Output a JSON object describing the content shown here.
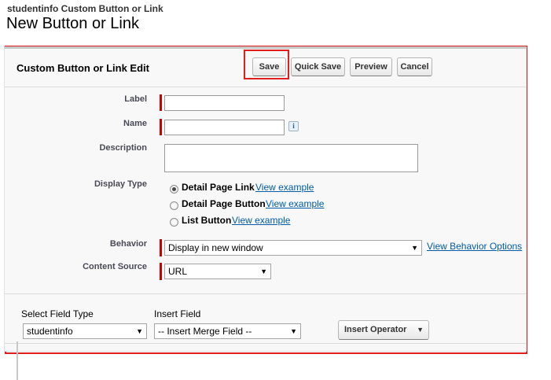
{
  "breadcrumb": "studentinfo Custom Button or Link",
  "page_title": "New Button or Link",
  "panel": {
    "title": "Custom Button or Link Edit",
    "buttons": {
      "save": "Save",
      "quick_save": "Quick Save",
      "preview": "Preview",
      "cancel": "Cancel"
    },
    "highlight_color": "#e01e1e"
  },
  "form": {
    "label": {
      "caption": "Label",
      "value": ""
    },
    "name": {
      "caption": "Name",
      "value": "",
      "info_icon_glyph": "i"
    },
    "description": {
      "caption": "Description",
      "value": ""
    },
    "display_type": {
      "caption": "Display Type",
      "options": [
        {
          "label": "Detail Page Link",
          "link": "View example",
          "selected": true
        },
        {
          "label": "Detail Page Button",
          "link": "View example",
          "selected": false
        },
        {
          "label": "List Button",
          "link": "View example",
          "selected": false
        }
      ]
    },
    "behavior": {
      "caption": "Behavior",
      "value": "Display in new window",
      "link": "View Behavior Options"
    },
    "content_source": {
      "caption": "Content Source",
      "value": "URL"
    }
  },
  "merge": {
    "select_field_type": {
      "caption": "Select Field Type",
      "value": "studentinfo"
    },
    "insert_field": {
      "caption": "Insert Field",
      "value": "-- Insert Merge Field --"
    },
    "insert_operator": "Insert Operator"
  },
  "colors": {
    "required_bar": "#cc0000",
    "link": "#015ba7"
  }
}
